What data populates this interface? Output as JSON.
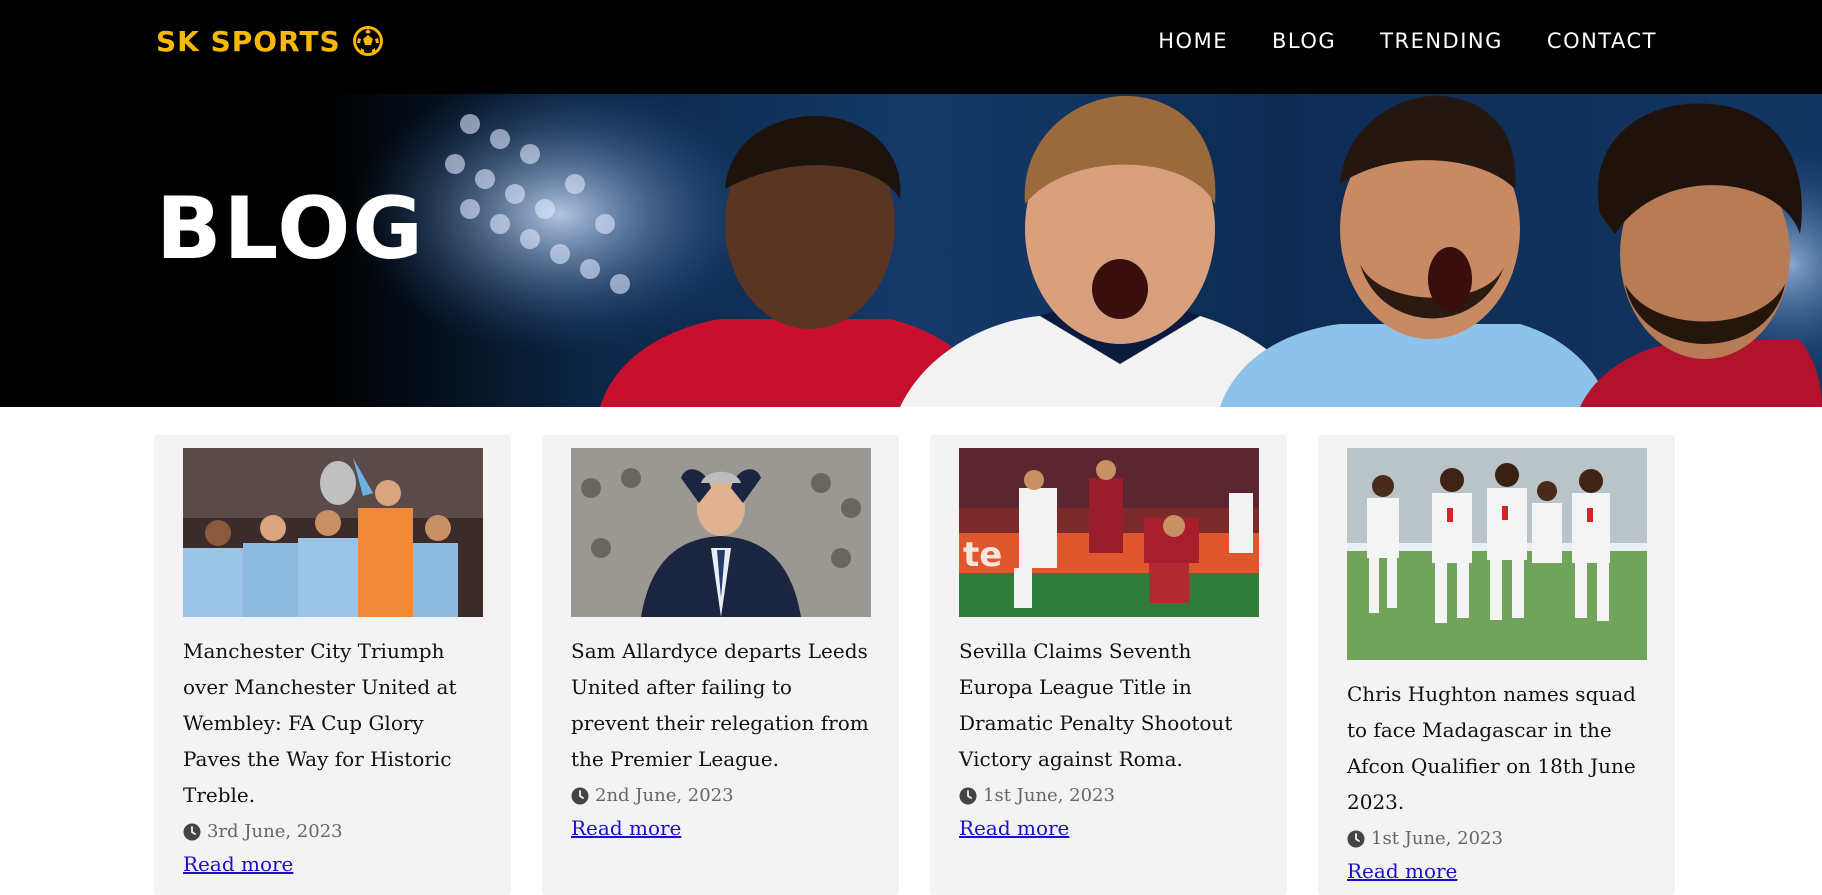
{
  "brand": {
    "name": "SK SPORTS",
    "accent": "#f6b800",
    "logo_icon": "soccer-ball-icon"
  },
  "nav": {
    "items": [
      {
        "label": "HOME"
      },
      {
        "label": "BLOG"
      },
      {
        "label": "TRENDING"
      },
      {
        "label": "CONTACT"
      }
    ]
  },
  "hero": {
    "title": "BLOG"
  },
  "posts": [
    {
      "title": "Manchester City Triumph over Manchester United at Wembley: FA Cup Glory Paves the Way for Historic Treble.",
      "date": "3rd June, 2023",
      "link_label": "Read more"
    },
    {
      "title": "Sam Allardyce departs Leeds United after failing to prevent their relegation from the Premier League.",
      "date": "2nd June, 2023",
      "link_label": "Read more"
    },
    {
      "title": "Sevilla Claims Seventh Europa League Title in Dramatic Penalty Shootout Victory against Roma.",
      "date": "1st June, 2023",
      "link_label": "Read more"
    },
    {
      "title": "Chris Hughton names squad to face Madagascar in the Afcon Qualifier on 18th June 2023.",
      "date": "1st June, 2023",
      "link_label": "Read more"
    }
  ]
}
